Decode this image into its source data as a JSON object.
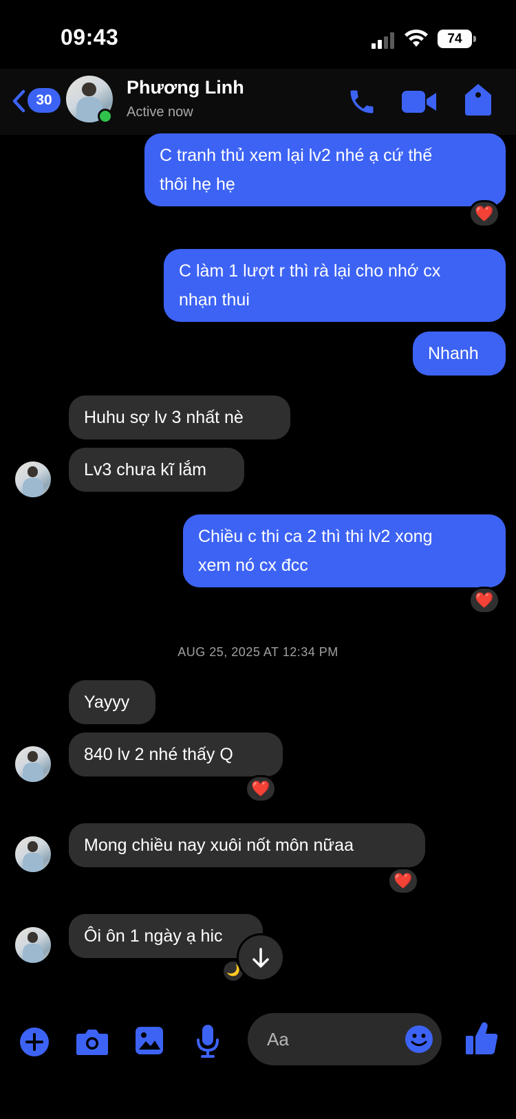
{
  "status_bar": {
    "time": "09:43",
    "battery": "74"
  },
  "header": {
    "unread_count": "30",
    "contact_name": "Phương Linh",
    "contact_status": "Active now"
  },
  "messages": [
    {
      "dir": "out",
      "lines": [
        "C tranh thủ xem lại lv2 nhé ạ cứ thế",
        "thôi hẹ hẹ"
      ],
      "reaction": "❤️"
    },
    {
      "dir": "out",
      "lines": [
        "C làm 1 lượt r thì rà lại cho nhớ cx",
        "nhạn thui"
      ]
    },
    {
      "dir": "out",
      "lines": [
        "Nhanh"
      ]
    },
    {
      "dir": "in",
      "lines": [
        "Huhu sợ lv 3 nhất nè"
      ]
    },
    {
      "dir": "in",
      "lines": [
        "Lv3 chưa kĩ lắm"
      ]
    },
    {
      "dir": "out",
      "lines": [
        "Chiều c thi ca 2 thì thi lv2 xong",
        "xem nó cx đcc"
      ],
      "reaction": "❤️"
    },
    {
      "dir": "in",
      "lines": [
        "Yayyy"
      ]
    },
    {
      "dir": "in",
      "lines": [
        "840 lv 2 nhé thấy Q"
      ],
      "reaction": "❤️"
    },
    {
      "dir": "in",
      "lines": [
        "Mong chiều nay xuôi nốt môn nữaa"
      ],
      "reaction": "❤️"
    },
    {
      "dir": "in",
      "lines": [
        "Ôi ôn 1 ngày ạ hic"
      ],
      "reaction": "🌙"
    }
  ],
  "timestamp": "AUG 25, 2025 AT 12:34 PM",
  "composer": {
    "placeholder": "Aa"
  },
  "colors": {
    "accent": "#3d63f5",
    "incoming_bubble": "#2f2f2f",
    "background": "#000000",
    "online": "#31c24d",
    "heart": "#f0354a"
  },
  "icons": [
    "back-chevron-icon",
    "phone-icon",
    "video-camera-icon",
    "info-tag-icon",
    "plus-icon",
    "camera-icon",
    "gallery-icon",
    "microphone-icon",
    "emoji-icon",
    "thumbs-up-icon",
    "arrow-down-icon",
    "heart-icon"
  ]
}
